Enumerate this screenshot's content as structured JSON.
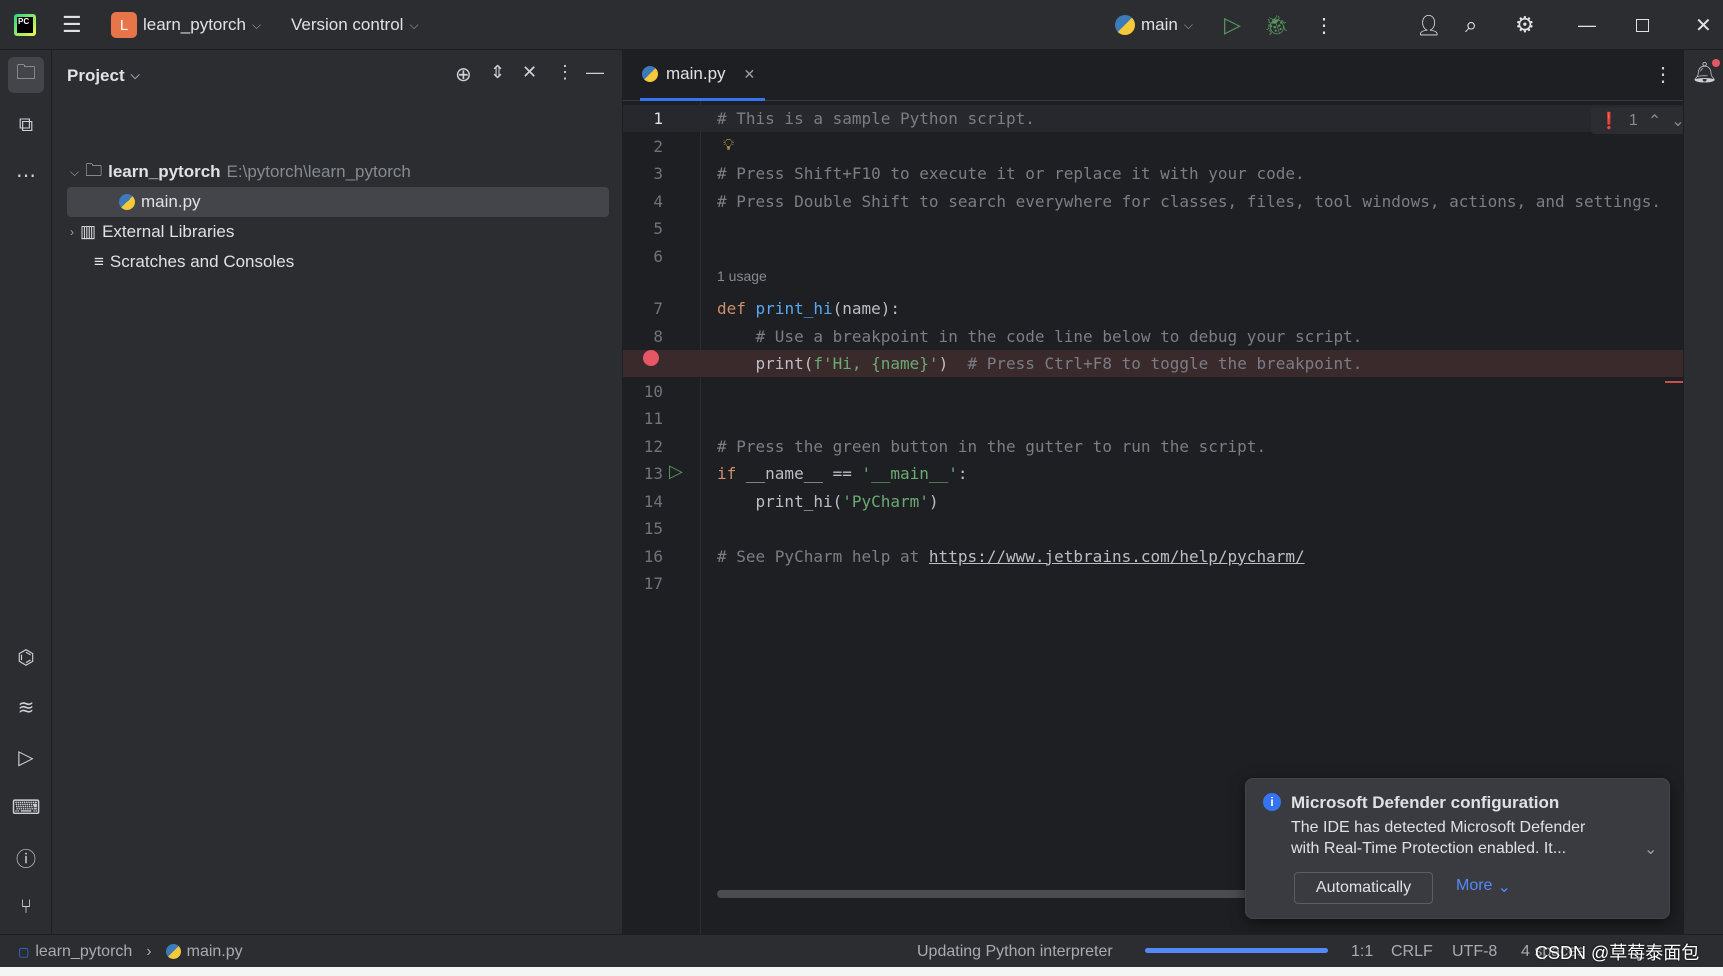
{
  "titlebar": {
    "project_initial": "L",
    "project_name": "learn_pytorch",
    "vcs": "Version control",
    "run_config": "main",
    "accent": "#e8754a"
  },
  "project_panel": {
    "title": "Project",
    "tree": [
      {
        "label": "learn_pytorch",
        "path": "E:\\pytorch\\learn_pytorch"
      },
      {
        "label": "main.py"
      },
      {
        "label": "External Libraries"
      },
      {
        "label": "Scratches and Consoles"
      }
    ]
  },
  "editor": {
    "tab": "main.py",
    "error_count": "1",
    "usage_hint": "1 usage",
    "lines": [
      {
        "n": "1",
        "code": "# This is a sample Python script."
      },
      {
        "n": "2",
        "code": ""
      },
      {
        "n": "3",
        "code": "# Press Shift+F10 to execute it or replace it with your code."
      },
      {
        "n": "4",
        "code": "# Press Double Shift to search everywhere for classes, files, tool windows, actions, and settings."
      },
      {
        "n": "5",
        "code": ""
      },
      {
        "n": "6",
        "code": ""
      },
      {
        "n": "7",
        "code": "def print_hi(name):"
      },
      {
        "n": "8",
        "code": "    # Use a breakpoint in the code line below to debug your script."
      },
      {
        "n": "9",
        "code": "    print(f'Hi, {name}')  # Press Ctrl+F8 to toggle the breakpoint."
      },
      {
        "n": "10",
        "code": ""
      },
      {
        "n": "11",
        "code": ""
      },
      {
        "n": "12",
        "code": "# Press the green button in the gutter to run the script."
      },
      {
        "n": "13",
        "code": "if __name__ == '__main__':"
      },
      {
        "n": "14",
        "code": "    print_hi('PyCharm')"
      },
      {
        "n": "15",
        "code": ""
      },
      {
        "n": "16",
        "code": "# See PyCharm help at https://www.jetbrains.com/help/pycharm/"
      },
      {
        "n": "17",
        "code": ""
      }
    ]
  },
  "notification": {
    "title": "Microsoft Defender configuration",
    "body1": "The IDE has detected Microsoft Defender",
    "body2": "with Real-Time Protection enabled. It...",
    "action": "Automatically",
    "more": "More"
  },
  "statusbar": {
    "crumb_project": "learn_pytorch",
    "crumb_file": "main.py",
    "task": "Updating Python interpreter",
    "progress_percent": 100,
    "position": "1:1",
    "line_sep": "CRLF",
    "encoding": "UTF-8",
    "indent": "4 spaces"
  },
  "watermark": "CSDN @草莓泰面包"
}
